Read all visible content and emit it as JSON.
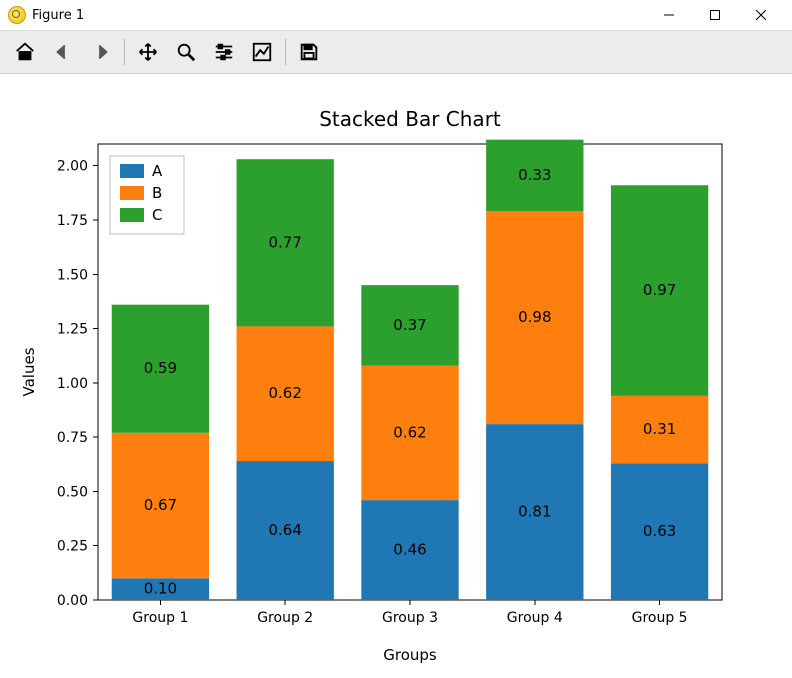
{
  "window": {
    "title": "Figure 1"
  },
  "toolbar": {
    "home": "Home",
    "back": "Back",
    "forward": "Forward",
    "pan": "Pan",
    "zoom": "Zoom",
    "subplots": "Configure subplots",
    "axes": "Edit axes",
    "save": "Save"
  },
  "chart_data": {
    "type": "bar",
    "stacked": true,
    "title": "Stacked Bar Chart",
    "xlabel": "Groups",
    "ylabel": "Values",
    "categories": [
      "Group 1",
      "Group 2",
      "Group 3",
      "Group 4",
      "Group 5"
    ],
    "series": [
      {
        "name": "A",
        "color": "#1f77b4",
        "values": [
          0.1,
          0.64,
          0.46,
          0.81,
          0.63
        ]
      },
      {
        "name": "B",
        "color": "#ff7f0e",
        "values": [
          0.67,
          0.62,
          0.62,
          0.98,
          0.31
        ]
      },
      {
        "name": "C",
        "color": "#2ca02c",
        "values": [
          0.59,
          0.77,
          0.37,
          0.33,
          0.97
        ]
      }
    ],
    "ylim": [
      0.0,
      2.1
    ],
    "yticks": [
      0.0,
      0.25,
      0.5,
      0.75,
      1.0,
      1.25,
      1.5,
      1.75,
      2.0
    ],
    "legend_position": "upper left"
  }
}
